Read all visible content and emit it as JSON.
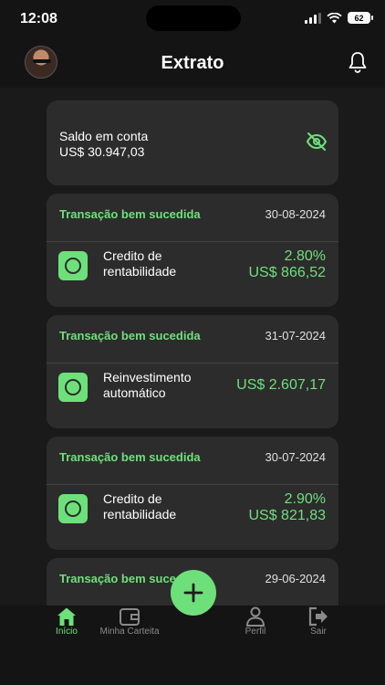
{
  "status_bar": {
    "time": "12:08",
    "battery": "62"
  },
  "header": {
    "title": "Extrato"
  },
  "balance": {
    "label": "Saldo em conta",
    "value": "US$ 30.947,03"
  },
  "transactions": [
    {
      "status": "Transação bem sucedida",
      "date": "30-08-2024",
      "desc_line1": "Credito de",
      "desc_line2": "rentabilidade",
      "percent": "2.80%",
      "amount": "US$ 866,52"
    },
    {
      "status": "Transação bem sucedida",
      "date": "31-07-2024",
      "desc_line1": "Reinvestimento",
      "desc_line2": "automático",
      "percent": "",
      "amount": "US$ 2.607,17"
    },
    {
      "status": "Transação bem sucedida",
      "date": "30-07-2024",
      "desc_line1": "Credito de",
      "desc_line2": "rentabilidade",
      "percent": "2.90%",
      "amount": "US$ 821,83"
    },
    {
      "status": "Transação bem sucedida",
      "date": "29-06-2024",
      "desc_line1": "",
      "desc_line2": "",
      "percent": "",
      "amount": ""
    }
  ],
  "nav": {
    "inicio": "Início",
    "carteira": "Minha Carteita",
    "perfil": "Perfil",
    "sair": "Sair"
  },
  "colors": {
    "accent": "#6ee07a",
    "background": "#1a1a1a",
    "card": "#2c2c2c"
  },
  "icons": {
    "avatar": "avatar",
    "bell": "bell-icon",
    "eye_off": "eye-off-icon",
    "home": "home-icon",
    "wallet": "wallet-icon",
    "user": "user-icon",
    "logout": "logout-icon",
    "add": "plus-icon"
  }
}
